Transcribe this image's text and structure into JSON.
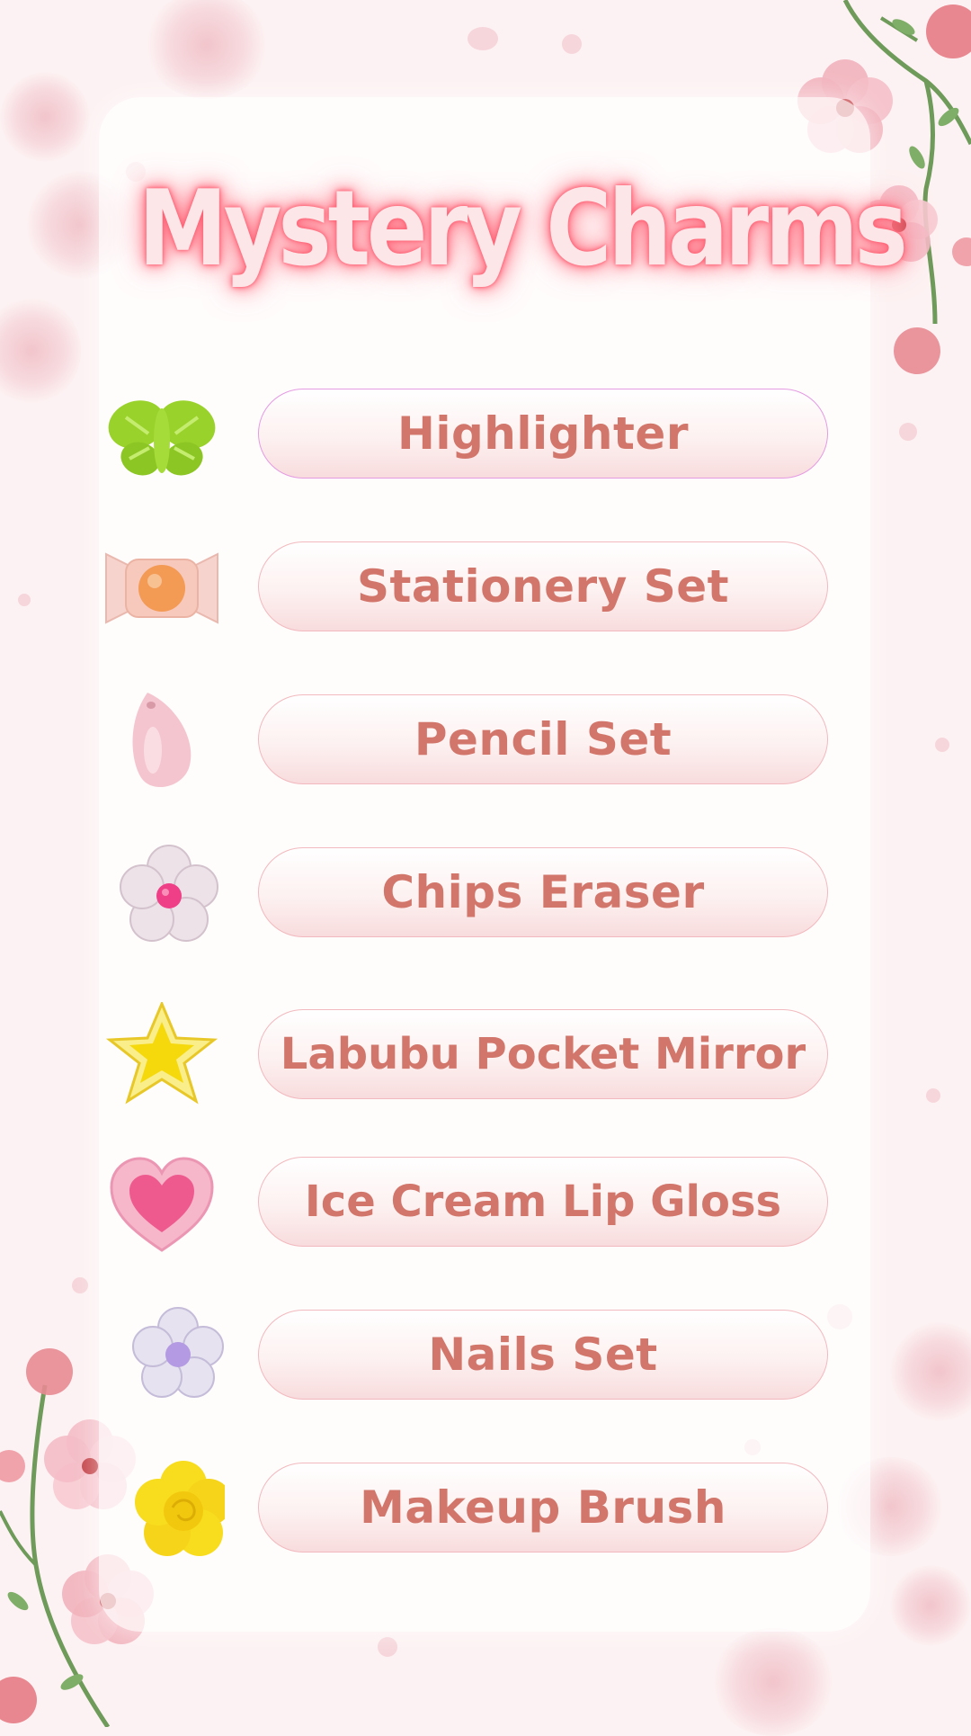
{
  "title": "Mystery Charms",
  "items": [
    {
      "label": "Highlighter",
      "charm": "butterfly-charm"
    },
    {
      "label": "Stationery Set",
      "charm": "candy-charm"
    },
    {
      "label": "Pencil Set",
      "charm": "teardrop-charm"
    },
    {
      "label": "Chips Eraser",
      "charm": "clear-flower-charm"
    },
    {
      "label": "Labubu Pocket Mirror",
      "charm": "star-charm"
    },
    {
      "label": "Ice Cream Lip Gloss",
      "charm": "heart-charm"
    },
    {
      "label": "Nails Set",
      "charm": "purple-flower-charm"
    },
    {
      "label": "Makeup Brush",
      "charm": "rose-charm"
    }
  ],
  "colors": {
    "background": "#fdf2f3",
    "title_fill": "#fde6e8",
    "title_glow": "#ff5a6e",
    "button_text": "#d2766b",
    "button_border": "#f2b9be"
  }
}
